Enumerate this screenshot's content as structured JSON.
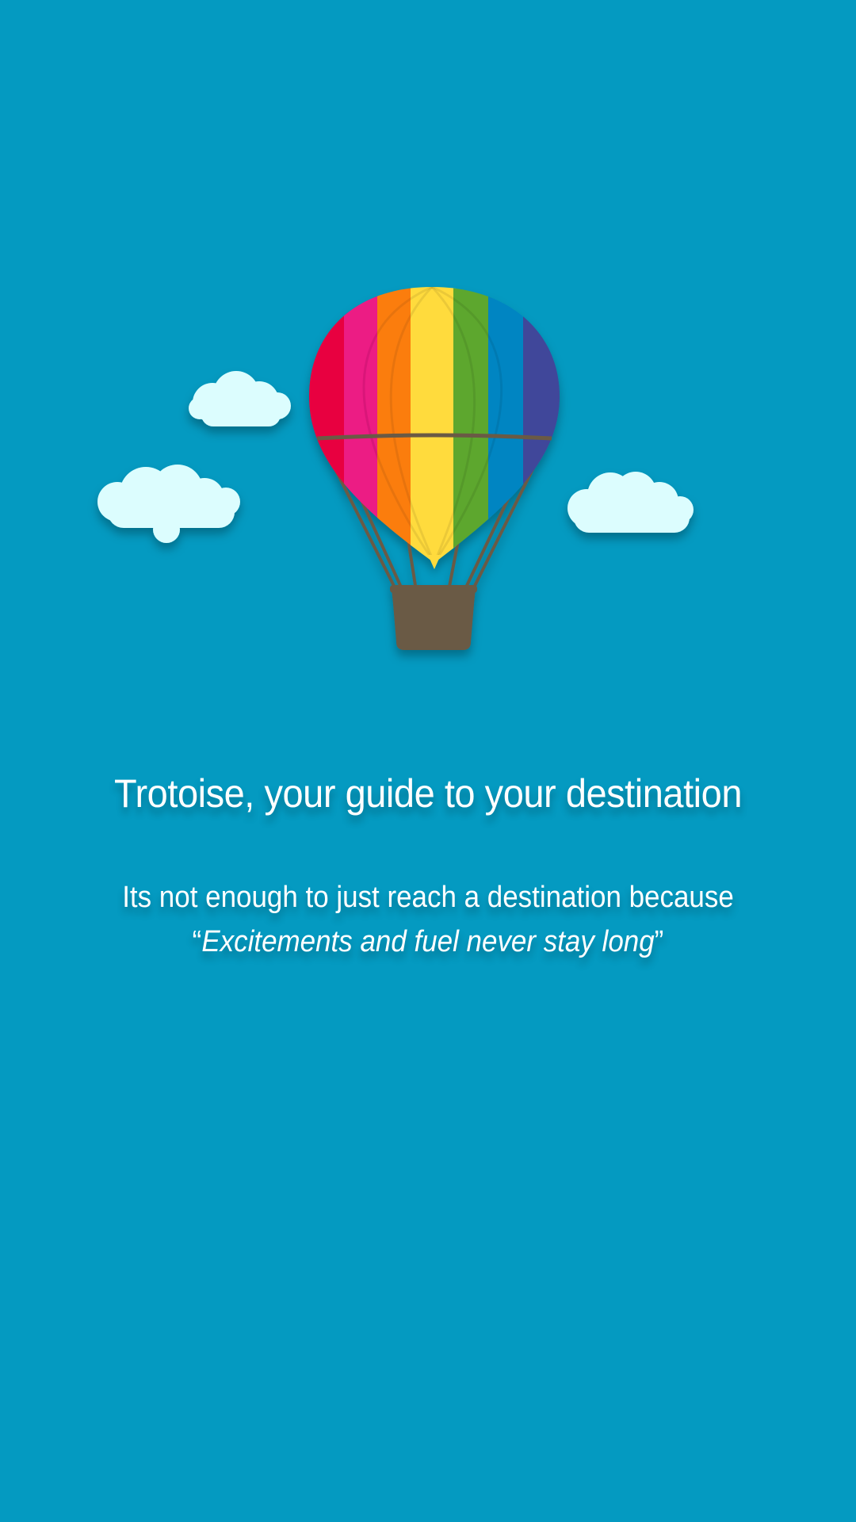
{
  "screen": {
    "background_color": "#049ac1"
  },
  "illustration": {
    "icons": [
      "hot-air-balloon-icon",
      "cloud-icon"
    ],
    "balloon_stripe_colors": [
      "#e8003f",
      "#ec1a84",
      "#fb7d08",
      "#ffdb3d",
      "#5da72d",
      "#0085c2",
      "#40479a"
    ],
    "basket_color": "#6b5a44",
    "cloud_color": "#dcfdfe"
  },
  "content": {
    "title": "Trotoise, your guide to your destination",
    "subtitle_line1": "Its not enough to just reach a destination because",
    "quote_open": "“",
    "quote_text": "Excitements and fuel never stay long",
    "quote_close": "”"
  }
}
